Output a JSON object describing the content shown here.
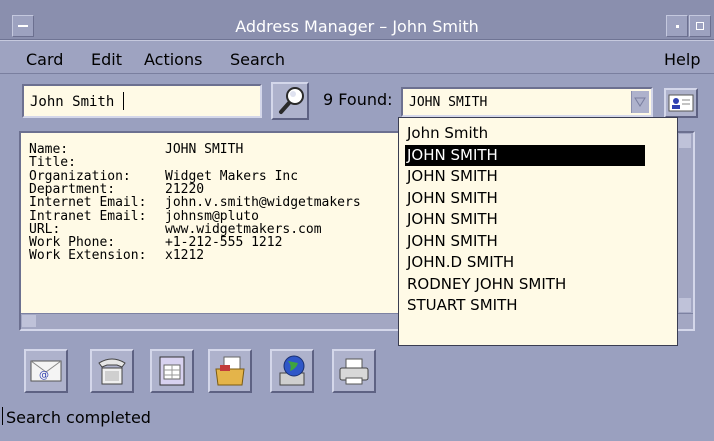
{
  "window": {
    "title": "Address Manager – John Smith"
  },
  "menubar": {
    "items": [
      "Card",
      "Edit",
      "Actions",
      "Search"
    ],
    "help": "Help"
  },
  "search": {
    "query": "John Smith",
    "found_label": "9 Found:",
    "selected": "JOHN SMITH"
  },
  "card": {
    "fields": [
      {
        "label": "Name:",
        "value": "JOHN SMITH"
      },
      {
        "label": "Title:",
        "value": ""
      },
      {
        "label": "Organization:",
        "value": "Widget Makers Inc"
      },
      {
        "label": "Department:",
        "value": "21220"
      },
      {
        "label": "Internet Email:",
        "value": "john.v.smith@widgetmakers"
      },
      {
        "label": "Intranet Email:",
        "value": "johnsm@pluto"
      },
      {
        "label": "URL:",
        "value": "www.widgetmakers.com"
      },
      {
        "label": "Work Phone:",
        "value": "+1-212-555 1212"
      },
      {
        "label": "Work Extension:",
        "value": "x1212"
      }
    ]
  },
  "results": [
    "John Smith",
    "JOHN SMITH",
    "JOHN SMITH",
    "JOHN SMITH",
    "JOHN SMITH",
    "JOHN SMITH",
    "JOHN.D SMITH",
    "RODNEY JOHN SMITH",
    "STUART SMITH"
  ],
  "selected_result_index": 1,
  "actions": [
    {
      "name": "email-action-icon"
    },
    {
      "name": "phone-action-icon"
    },
    {
      "name": "calendar-action-icon"
    },
    {
      "name": "open-folder-action-icon"
    },
    {
      "name": "web-globe-action-icon"
    },
    {
      "name": "print-action-icon"
    }
  ],
  "status": {
    "text": "Search completed"
  },
  "colors": {
    "background": "#9aa0bf",
    "field": "#fffae6",
    "selection": "#000000"
  }
}
